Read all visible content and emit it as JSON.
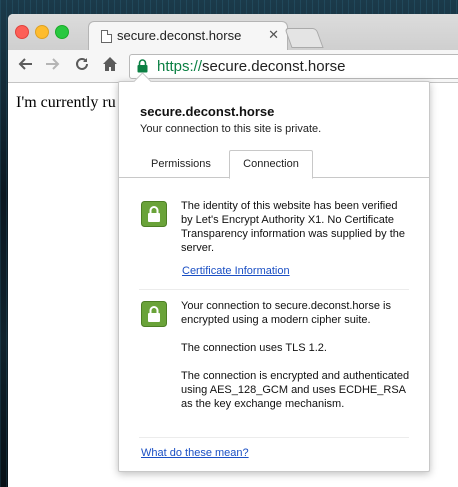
{
  "browser": {
    "tab": {
      "title": "secure.deconst.horse"
    },
    "address": {
      "scheme": "https://",
      "host": "secure.deconst.horse"
    }
  },
  "page": {
    "text": "I'm currently ru"
  },
  "popup": {
    "site_name": "secure.deconst.horse",
    "site_status": "Your connection to this site is private.",
    "tabs": {
      "permissions": "Permissions",
      "connection": "Connection"
    },
    "identity_text": "The identity of this website has been verified by Let's Encrypt Authority X1. No Certificate Transparency information was supplied by the server.",
    "certificate_link": "Certificate Information",
    "encryption_p1": "Your connection to secure.deconst.horse is encrypted using a modern cipher suite.",
    "encryption_p2": "The connection uses TLS 1.2.",
    "encryption_p3": "The connection is encrypted and authenticated using AES_128_GCM and uses ECDHE_RSA as the key exchange mechanism.",
    "help_link": "What do these mean?"
  },
  "colors": {
    "secure_green": "#0b8043",
    "link_blue": "#1a4fc4",
    "shield_green": "#6aa339"
  },
  "icons": [
    "document-icon",
    "close-icon",
    "back-arrow-icon",
    "forward-arrow-icon",
    "reload-icon",
    "home-icon",
    "lock-icon",
    "shield-lock-icon"
  ]
}
